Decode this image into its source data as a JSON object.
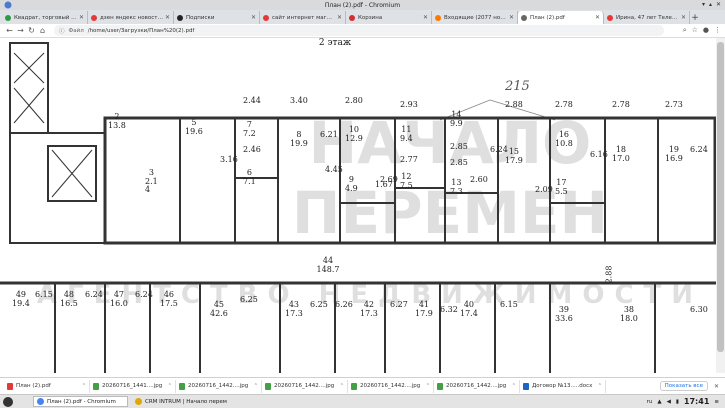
{
  "window": {
    "title": "План (2).pdf - Chromium"
  },
  "tabs": [
    {
      "label": "Квадрат, торговый центр",
      "fav": "#2e9a44",
      "active": false
    },
    {
      "label": "дзен яндекс новости — Я...",
      "fav": "#e53935",
      "active": false
    },
    {
      "label": "Подписки",
      "fav": "#222222",
      "active": false
    },
    {
      "label": "сайт интернет магазин с...",
      "fav": "#e53935",
      "active": false
    },
    {
      "label": "Корзина",
      "fav": "#d32f2f",
      "active": false
    },
    {
      "label": "Входящие (2077 новых п...",
      "fav": "#ff7a00",
      "active": false
    },
    {
      "label": "План (2).pdf",
      "fav": "#666666",
      "active": true
    },
    {
      "label": "Ирина, 47 лет Телец, Росс...",
      "fav": "#e53935",
      "active": false
    }
  ],
  "toolbar": {
    "scheme": "Файл",
    "url": "/home/user/Загрузки/План%20(2).pdf"
  },
  "plan": {
    "floor_label": "2 этаж",
    "dimension": "215",
    "watermark_top": "НАЧАЛО",
    "watermark_mid": "ПЕРЕМЕН",
    "watermark_bottom": "АГЕНТСТВО НЕДВИЖИМОСТИ",
    "corridor_room": {
      "num": "44",
      "area": "148.7"
    },
    "corridor_dim": "2.88",
    "upper_rooms": [
      {
        "num": "2",
        "area": "13.8"
      },
      {
        "num": "5",
        "area": "19.6"
      },
      {
        "num": "3",
        "area": "2.1"
      },
      {
        "num": "4",
        "area": ""
      },
      {
        "num": "",
        "area": "2.44"
      },
      {
        "num": "7",
        "area": "7.2"
      },
      {
        "num": "",
        "area": "2.46"
      },
      {
        "num": "6",
        "area": "7.1"
      },
      {
        "num": "",
        "area": "3.16"
      },
      {
        "num": "",
        "area": "3.40"
      },
      {
        "num": "8",
        "area": "19.9"
      },
      {
        "num": "",
        "area": "6.21"
      },
      {
        "num": "",
        "area": "2.80"
      },
      {
        "num": "10",
        "area": "12.9"
      },
      {
        "num": "",
        "area": "4.45"
      },
      {
        "num": "9",
        "area": "4.9"
      },
      {
        "num": "",
        "area": "1.67"
      },
      {
        "num": "",
        "area": "2.93"
      },
      {
        "num": "11",
        "area": "9.4"
      },
      {
        "num": "",
        "area": "2.77"
      },
      {
        "num": "12",
        "area": "7.5"
      },
      {
        "num": "",
        "area": "2.69"
      },
      {
        "num": "14",
        "area": "9.9"
      },
      {
        "num": "",
        "area": "2.85"
      },
      {
        "num": "",
        "area": "2.85"
      },
      {
        "num": "13",
        "area": "7.3"
      },
      {
        "num": "",
        "area": "2.60"
      },
      {
        "num": "",
        "area": "2.88"
      },
      {
        "num": "15",
        "area": "17.9"
      },
      {
        "num": "",
        "area": "6.24"
      },
      {
        "num": "",
        "area": "2.78"
      },
      {
        "num": "16",
        "area": "10.8"
      },
      {
        "num": "17",
        "area": "5.5"
      },
      {
        "num": "",
        "area": "2.09"
      },
      {
        "num": "",
        "area": "6.16"
      },
      {
        "num": "",
        "area": "2.78"
      },
      {
        "num": "18",
        "area": "17.0"
      },
      {
        "num": "",
        "area": "2.73"
      },
      {
        "num": "19",
        "area": "16.9"
      },
      {
        "num": "",
        "area": "6.24"
      }
    ],
    "lower_rooms": [
      {
        "num": "49",
        "area": "19.4"
      },
      {
        "num": "",
        "area": "6.15"
      },
      {
        "num": "48",
        "area": "16.5"
      },
      {
        "num": "",
        "area": "6.24"
      },
      {
        "num": "47",
        "area": "16.0"
      },
      {
        "num": "",
        "area": "6.24"
      },
      {
        "num": "46",
        "area": "17.5"
      },
      {
        "num": "45",
        "area": "42.6"
      },
      {
        "num": "",
        "area": "6.25"
      },
      {
        "num": "43",
        "area": "17.3"
      },
      {
        "num": "",
        "area": "6.25"
      },
      {
        "num": "",
        "area": "6.26"
      },
      {
        "num": "42",
        "area": "17.3"
      },
      {
        "num": "",
        "area": "6.27"
      },
      {
        "num": "41",
        "area": "17.9"
      },
      {
        "num": "",
        "area": "6.32"
      },
      {
        "num": "40",
        "area": "17.4"
      },
      {
        "num": "",
        "area": "6.15"
      },
      {
        "num": "39",
        "area": "33.6"
      },
      {
        "num": "38",
        "area": "18.0"
      },
      {
        "num": "",
        "area": "6.30"
      }
    ]
  },
  "downloads": {
    "items": [
      {
        "label": "План (2).pdf",
        "color": "#e53935"
      },
      {
        "label": "20260716_1441....jpg",
        "color": "#43a047"
      },
      {
        "label": "20260716_1442....jpg",
        "color": "#43a047"
      },
      {
        "label": "20260716_1442....jpg",
        "color": "#43a047"
      },
      {
        "label": "20260716_1442....jpg",
        "color": "#43a047"
      },
      {
        "label": "20260716_1442....jpg",
        "color": "#43a047"
      },
      {
        "label": "Договор №13.....docx",
        "color": "#1e63c6"
      }
    ],
    "show_all": "Показать все"
  },
  "taskbar": {
    "tasks": [
      {
        "label": "План (2).pdf - Chromium",
        "active": true,
        "color": "#4285f4"
      },
      {
        "label": "CRM INTRUM | Начало перемен, ...",
        "active": false,
        "color": "#e0a800"
      }
    ],
    "lang": "ru",
    "time": "17:41"
  }
}
